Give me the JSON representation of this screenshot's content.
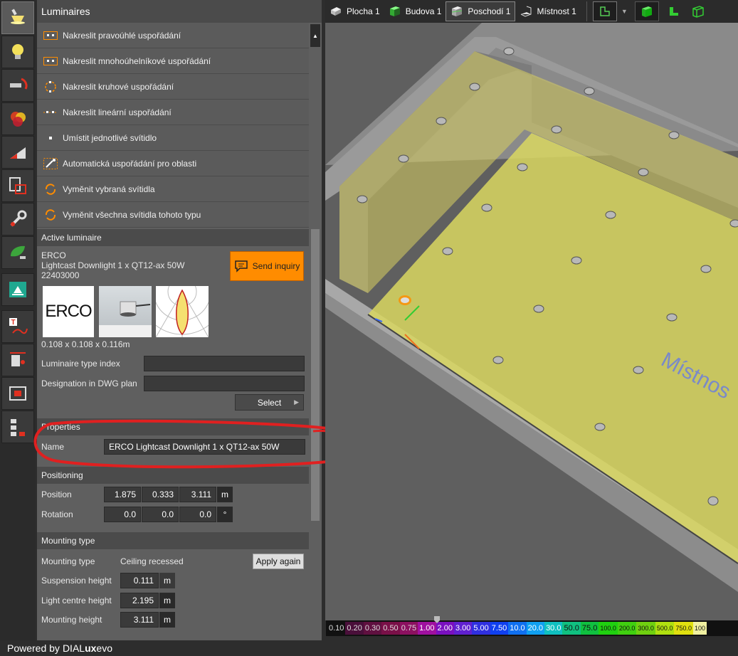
{
  "panel": {
    "title": "Luminaires",
    "menu": [
      {
        "label": "Nakreslit pravoúhlé uspořádání",
        "icon": "rectangular-arrangement-icon"
      },
      {
        "label": "Nakreslit mnohoúhelníkové uspořádání",
        "icon": "polygonal-arrangement-icon"
      },
      {
        "label": "Nakreslit kruhové uspořádání",
        "icon": "circular-arrangement-icon"
      },
      {
        "label": "Nakreslit lineární uspořádání",
        "icon": "linear-arrangement-icon"
      },
      {
        "label": "Umístit jednotlivé svítidlo",
        "icon": "single-luminaire-icon"
      },
      {
        "label": "Automatická uspořádání pro oblasti",
        "icon": "magic-wand-icon"
      },
      {
        "label": "Vyměnit vybraná svítidla",
        "icon": "replace-icon"
      },
      {
        "label": "Vyměnit všechna svítidla tohoto typu",
        "icon": "replace-all-icon"
      }
    ],
    "active": {
      "header": "Active luminaire",
      "manufacturer": "ERCO",
      "name": "Lightcast Downlight 1 x QT12-ax 50W",
      "article": "22403000",
      "send_inquiry": "Send inquiry",
      "logo_text": "ERCO",
      "dimensions": "0.108 x 0.108 x 0.116m",
      "type_index_label": "Luminaire type index",
      "type_index_value": "",
      "dwg_label": "Designation in DWG plan",
      "dwg_value": "",
      "select": "Select"
    },
    "properties": {
      "header": "Properties",
      "name_label": "Name",
      "name_value": "ERCO Lightcast Downlight 1 x QT12-ax 50W"
    },
    "positioning": {
      "header": "Positioning",
      "position_label": "Position",
      "position": [
        "1.875",
        "0.333",
        "3.111"
      ],
      "position_unit": "m",
      "rotation_label": "Rotation",
      "rotation": [
        "0.0",
        "0.0",
        "0.0"
      ],
      "rotation_unit": "°"
    },
    "mounting": {
      "header": "Mounting type",
      "type_label": "Mounting type",
      "type_value": "Ceiling recessed",
      "apply": "Apply again",
      "suspension_label": "Suspension height",
      "suspension_value": "0.111",
      "light_centre_label": "Light centre height",
      "light_centre_value": "2.195",
      "mounting_height_label": "Mounting height",
      "mounting_height_value": "3.111",
      "unit": "m"
    }
  },
  "viewport": {
    "tabs": [
      {
        "label": "Plocha 1",
        "selected": false
      },
      {
        "label": "Budova 1",
        "selected": false
      },
      {
        "label": "Poschodí 1",
        "selected": true
      },
      {
        "label": "Místnost 1",
        "selected": false
      }
    ],
    "room_label": "Místnos"
  },
  "scale": {
    "values": [
      "0.10",
      "0.20",
      "0.30",
      "0.50",
      "0.75",
      "1.00",
      "2.00",
      "3.00",
      "5.00",
      "7.50",
      "10.0",
      "20.0",
      "30.0",
      "50.0",
      "75.0",
      "100.0",
      "200.0",
      "300.0",
      "500.0",
      "750.0",
      "100"
    ],
    "colors": [
      "#111",
      "#4a0f3a",
      "#601040",
      "#7a1048",
      "#8c1060",
      "#a010a0",
      "#7a10c0",
      "#6020d0",
      "#3030e0",
      "#1040f0",
      "#1070f0",
      "#10a0f0",
      "#10c0c0",
      "#10c080",
      "#10c040",
      "#20d010",
      "#40d010",
      "#70d010",
      "#b0e010",
      "#e0e010",
      "#f0f0a0"
    ],
    "text_colors": [
      "#ddd",
      "#ddd",
      "#ddd",
      "#ddd",
      "#ddd",
      "#fff",
      "#fff",
      "#fff",
      "#fff",
      "#fff",
      "#fff",
      "#fff",
      "#fff",
      "#111",
      "#111",
      "#111",
      "#111",
      "#111",
      "#111",
      "#111",
      "#111"
    ]
  },
  "footer": {
    "powered": "Powered by ",
    "brand_a": "DIAL",
    "brand_b": "ux",
    "brand_c": " evo"
  },
  "colors": {
    "accent": "#ff8c00",
    "annotation": "#e02020"
  }
}
